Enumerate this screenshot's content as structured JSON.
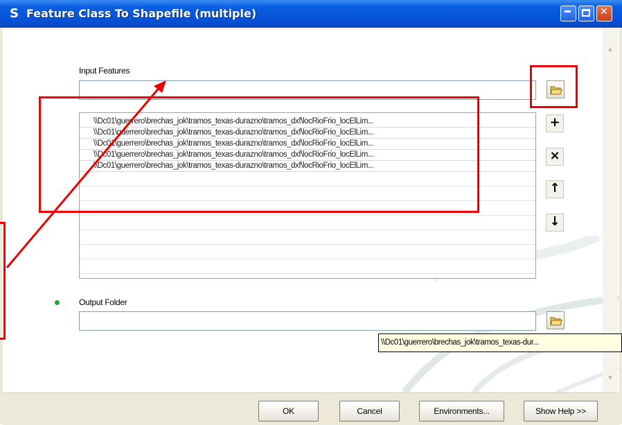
{
  "window": {
    "title": "Feature Class To Shapefile (multiple)",
    "app_icon_glyph": "S"
  },
  "input_features": {
    "label": "Input Features",
    "value": "",
    "items": [
      "\\\\Dc01\\guerrero\\brechas_jok\\tramos_texas-durazno\\tramos_dxf\\locRioFrio_locElLim...",
      "\\\\Dc01\\guerrero\\brechas_jok\\tramos_texas-durazno\\tramos_dxf\\locRioFrio_locElLim...",
      "\\\\Dc01\\guerrero\\brechas_jok\\tramos_texas-durazno\\tramos_dxf\\locRioFrio_locElLim...",
      "\\\\Dc01\\guerrero\\brechas_jok\\tramos_texas-durazno\\tramos_dxf\\locRioFrio_locElLim...",
      "\\\\Dc01\\guerrero\\brechas_jok\\tramos_texas-durazno\\tramos_dxf\\locRioFrio_locElLim..."
    ]
  },
  "side_buttons": {
    "add": "+",
    "remove": "×",
    "up": "↑",
    "down": "↓"
  },
  "output_folder": {
    "label": "Output Folder",
    "value": "",
    "tooltip": "\\\\Dc01\\guerrero\\brechas_jok\\tramos_texas-dur..."
  },
  "buttons": {
    "ok": "OK",
    "cancel": "Cancel",
    "environments": "Environments...",
    "show_help": "Show Help >>"
  },
  "colors": {
    "annotation": "#ee0000",
    "titlebar": "#0552d8",
    "required_dot": "#27a33a"
  }
}
